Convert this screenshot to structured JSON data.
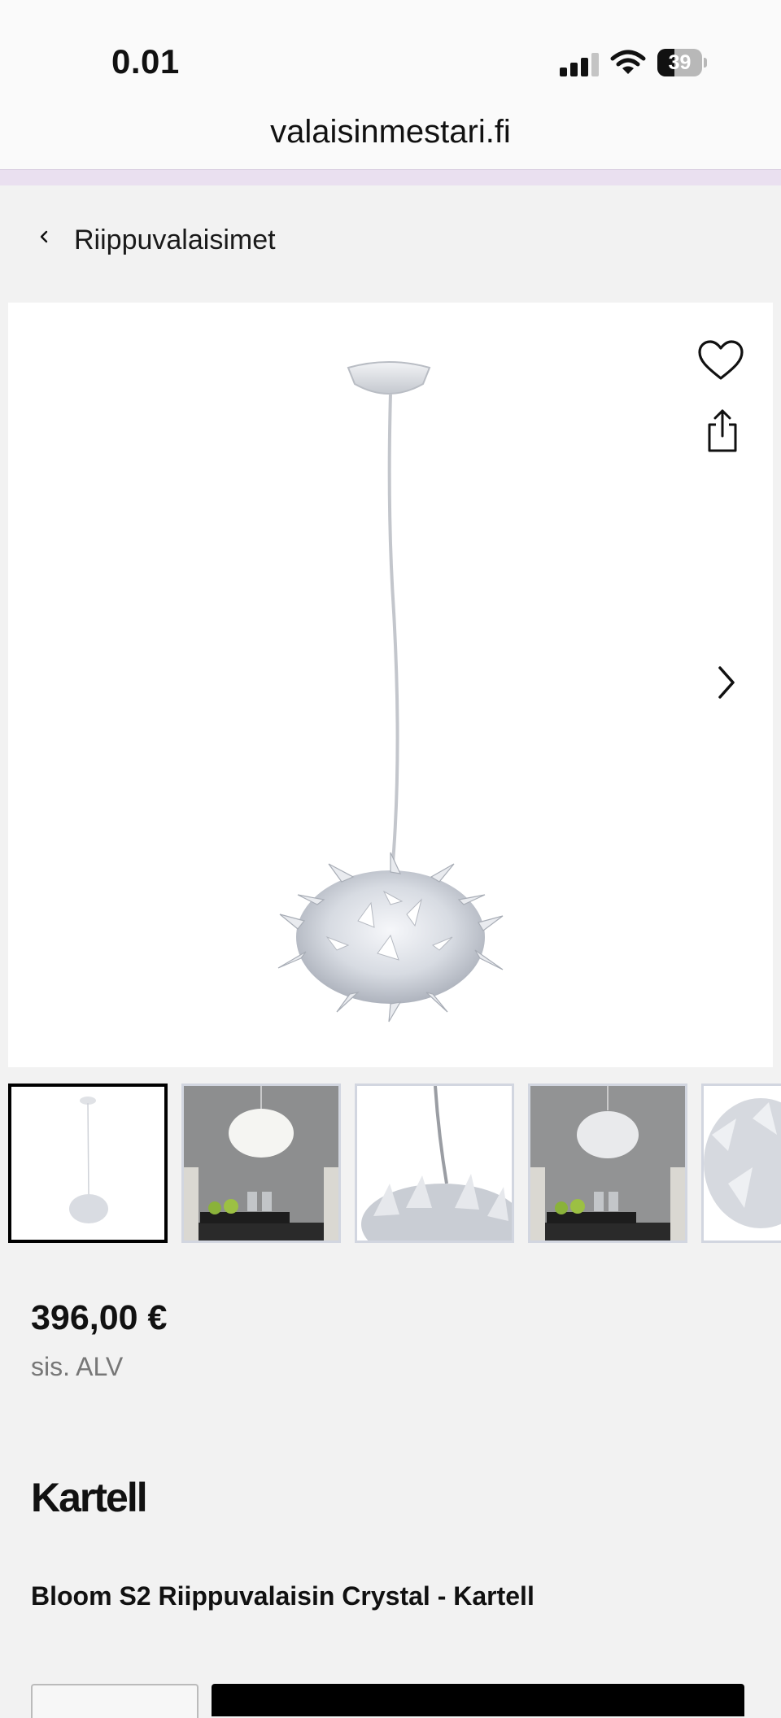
{
  "status_bar": {
    "time": "0.01",
    "battery_level": "39"
  },
  "browser": {
    "url": "valaisinmestari.fi"
  },
  "nav": {
    "back_label": "Riippuvalaisimet"
  },
  "gallery": {
    "icons": [
      "heart-icon",
      "share-icon",
      "chevron-right-icon"
    ],
    "thumbnail_count_visible": 5,
    "active_index": 0
  },
  "product": {
    "price": "396,00 €",
    "vat_note": "sis. ALV",
    "brand": "Kartell",
    "title": "Bloom S2 Riippuvalaisin Crystal - Kartell"
  },
  "colors": {
    "accent_strip": "#eae0f0",
    "background": "#f2f2f2",
    "button": "#000000"
  }
}
